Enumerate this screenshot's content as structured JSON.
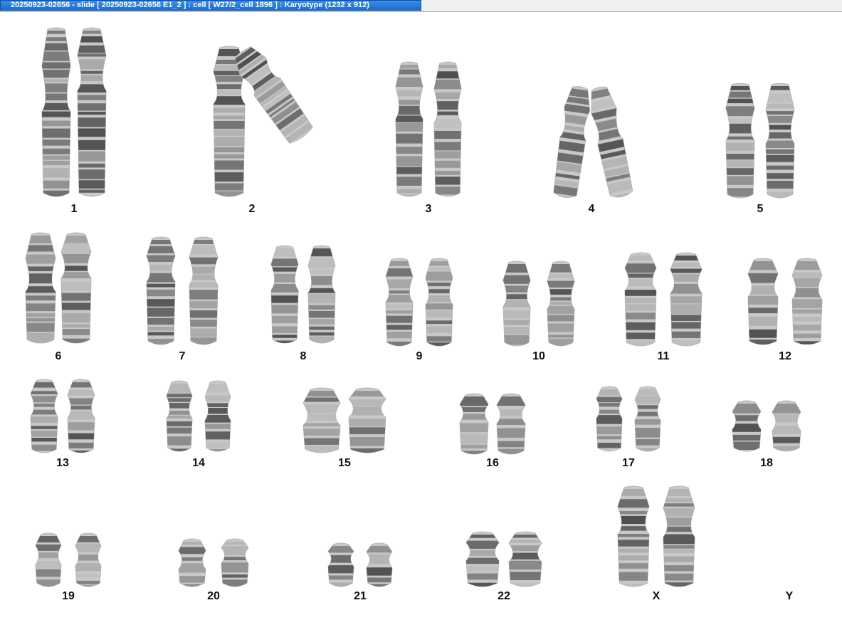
{
  "window": {
    "title": "20250923-02656 - slide [ 20250923-02656 E1_2 ] : cell [ W27/2_cell 1896 ] : Karyotype  (1232 x 912)"
  },
  "karyotype": {
    "chromosomes": [
      {
        "label": "1",
        "present": 2
      },
      {
        "label": "2",
        "present": 2
      },
      {
        "label": "3",
        "present": 2
      },
      {
        "label": "4",
        "present": 2
      },
      {
        "label": "5",
        "present": 2
      },
      {
        "label": "6",
        "present": 2
      },
      {
        "label": "7",
        "present": 2
      },
      {
        "label": "8",
        "present": 2
      },
      {
        "label": "9",
        "present": 2
      },
      {
        "label": "10",
        "present": 2
      },
      {
        "label": "11",
        "present": 2
      },
      {
        "label": "12",
        "present": 2
      },
      {
        "label": "13",
        "present": 2
      },
      {
        "label": "14",
        "present": 2
      },
      {
        "label": "15",
        "present": 2
      },
      {
        "label": "16",
        "present": 2
      },
      {
        "label": "17",
        "present": 2
      },
      {
        "label": "18",
        "present": 2
      },
      {
        "label": "19",
        "present": 2
      },
      {
        "label": "20",
        "present": 2
      },
      {
        "label": "21",
        "present": 2
      },
      {
        "label": "22",
        "present": 2
      },
      {
        "label": "X",
        "present": 2
      },
      {
        "label": "Y",
        "present": 0
      }
    ]
  }
}
